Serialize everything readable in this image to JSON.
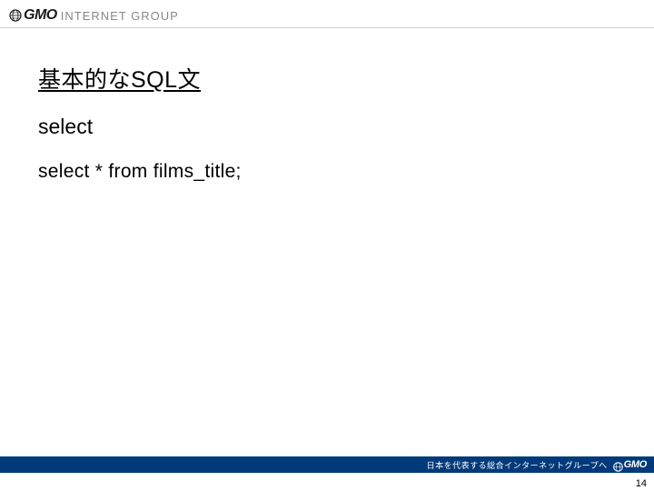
{
  "header": {
    "logo_prefix": "GMO",
    "logo_suffix": "INTERNET GROUP"
  },
  "slide": {
    "title": "基本的なSQL文",
    "subtitle": "select",
    "code": "select * from films_title;"
  },
  "footer": {
    "tagline": "日本を代表する総合インターネットグループへ",
    "logo": "GMO",
    "page_number": "14"
  }
}
